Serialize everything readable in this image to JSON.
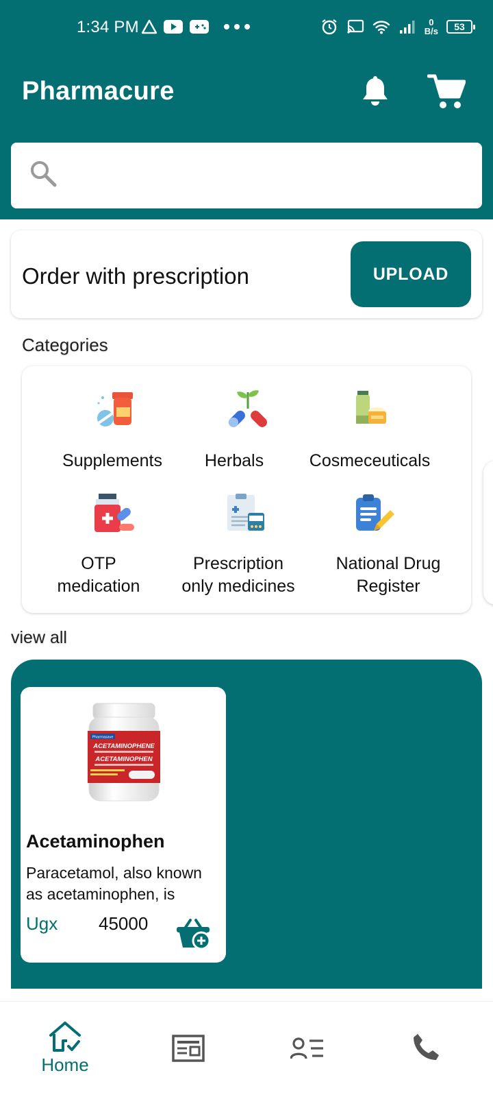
{
  "status_bar": {
    "time": "1:34 PM",
    "net_speed_value": "0",
    "net_speed_unit": "B/s",
    "battery": "53"
  },
  "header": {
    "title": "Pharmacure",
    "icons": [
      "bell-icon",
      "cart-icon"
    ]
  },
  "search": {
    "placeholder": "",
    "icon": "search-icon"
  },
  "prescription": {
    "text": "Order with prescription",
    "button_label": "UPLOAD"
  },
  "categories": {
    "heading": "Categories",
    "items": [
      {
        "label": "Supplements",
        "icon": "supplements-icon"
      },
      {
        "label": "Herbals",
        "icon": "herbals-icon"
      },
      {
        "label": "Cosmeceuticals",
        "icon": "cosmeceuticals-icon"
      },
      {
        "label_line1": "OTP",
        "label_line2": "medication",
        "icon": "otp-medication-icon"
      },
      {
        "label_line1": "Prescription",
        "label_line2": "only medicines",
        "icon": "prescription-icon"
      },
      {
        "label_line1": "National Drug",
        "label_line2": "Register",
        "icon": "drug-register-icon"
      }
    ],
    "view_all": "view all"
  },
  "products": [
    {
      "name": "Acetaminophen",
      "description": "Paracetamol, also known as acetaminophen, is",
      "currency": "Ugx",
      "price": "45000",
      "label_brand": "Pharmasave",
      "label_line1": "ACETAMINOPHENE",
      "label_line2": "ACETAMINOPHEN"
    }
  ],
  "bottom_nav": {
    "items": [
      {
        "label": "Home",
        "icon": "home-icon",
        "active": true
      },
      {
        "label": "",
        "icon": "news-icon"
      },
      {
        "label": "",
        "icon": "profile-list-icon"
      },
      {
        "label": "",
        "icon": "phone-icon"
      }
    ]
  },
  "colors": {
    "primary": "#036f72",
    "background": "#ffffff",
    "text": "#111111"
  }
}
